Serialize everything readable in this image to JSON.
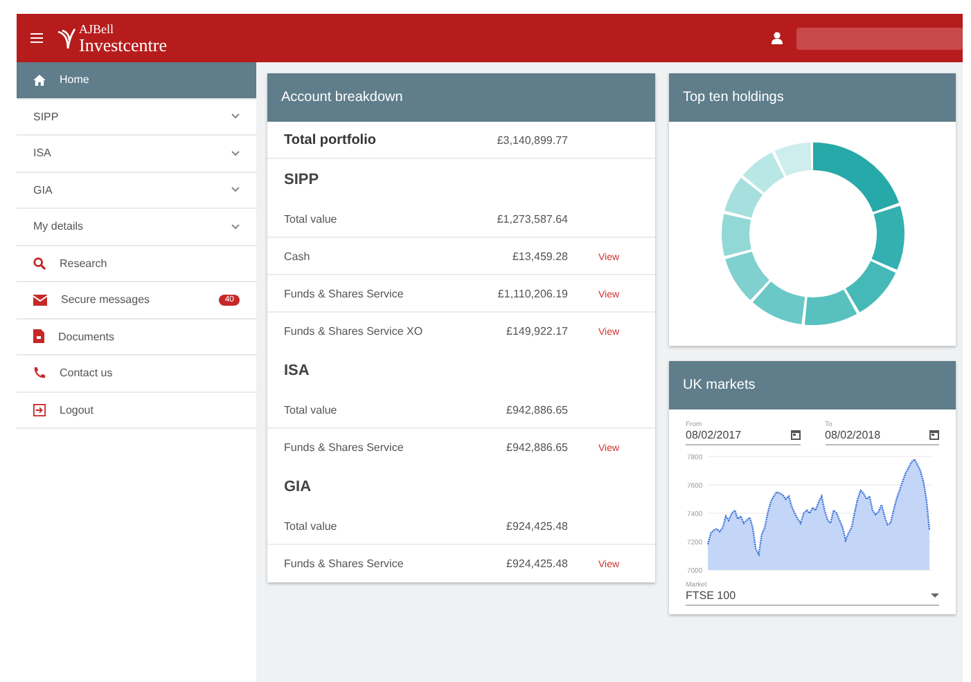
{
  "header": {
    "logo_top": "AJBell",
    "logo_bottom": "Investcentre"
  },
  "sidebar": {
    "items": [
      {
        "label": "Home",
        "kind": "home",
        "selected": true
      },
      {
        "label": "SIPP",
        "kind": "dropdown",
        "selected": false
      },
      {
        "label": "ISA",
        "kind": "dropdown",
        "selected": false
      },
      {
        "label": "GIA",
        "kind": "dropdown",
        "selected": false
      },
      {
        "label": "My details",
        "kind": "dropdown",
        "selected": false
      },
      {
        "label": "Research",
        "kind": "search",
        "selected": false
      },
      {
        "label": "Secure messages",
        "kind": "mail",
        "selected": false,
        "badge": "40"
      },
      {
        "label": "Documents",
        "kind": "document",
        "selected": false
      },
      {
        "label": "Contact us",
        "kind": "phone",
        "selected": false
      },
      {
        "label": "Logout",
        "kind": "logout",
        "selected": false
      }
    ]
  },
  "account_breakdown": {
    "title": "Account breakdown",
    "total_label": "Total portfolio",
    "total_value": "£3,140,899.77",
    "sections": [
      {
        "title": "SIPP",
        "rows": [
          {
            "label": "Total value",
            "value": "£1,273,587.64"
          },
          {
            "label": "Cash",
            "value": "£13,459.28",
            "link": "View"
          },
          {
            "label": "Funds & Shares Service",
            "value": "£1,110,206.19",
            "link": "View"
          },
          {
            "label": "Funds & Shares Service XO",
            "value": "£149,922.17",
            "link": "View"
          }
        ]
      },
      {
        "title": "ISA",
        "rows": [
          {
            "label": "Total value",
            "value": "£942,886.65"
          },
          {
            "label": "Funds & Shares Service",
            "value": "£942,886.65",
            "link": "View"
          }
        ]
      },
      {
        "title": "GIA",
        "rows": [
          {
            "label": "Total value",
            "value": "£924,425.48"
          },
          {
            "label": "Funds & Shares Service",
            "value": "£924,425.48",
            "link": "View"
          }
        ]
      }
    ]
  },
  "top_holdings": {
    "title": "Top ten holdings"
  },
  "uk_markets": {
    "title": "UK markets",
    "from": {
      "label": "From",
      "value": "08/02/2017"
    },
    "to": {
      "label": "To",
      "value": "08/02/2018"
    },
    "chart_data": {
      "type": "area",
      "grid": true,
      "ylim": [
        7000,
        7800
      ],
      "yticks": [
        7000,
        7200,
        7400,
        7600,
        7800
      ],
      "series": [
        {
          "color": "#3b6fd9",
          "values": [
            7180,
            7260,
            7280,
            7290,
            7270,
            7300,
            7380,
            7350,
            7400,
            7420,
            7360,
            7380,
            7330,
            7350,
            7370,
            7300,
            7150,
            7110,
            7250,
            7300,
            7400,
            7480,
            7520,
            7550,
            7540,
            7530,
            7500,
            7520,
            7450,
            7400,
            7360,
            7330,
            7400,
            7420,
            7400,
            7440,
            7420,
            7480,
            7520,
            7420,
            7350,
            7330,
            7420,
            7400,
            7350,
            7300,
            7210,
            7260,
            7300,
            7400,
            7500,
            7560,
            7540,
            7500,
            7520,
            7420,
            7390,
            7410,
            7460,
            7380,
            7320,
            7330,
            7420,
            7500,
            7560,
            7620,
            7680,
            7720,
            7760,
            7780,
            7740,
            7700,
            7620,
            7500,
            7280
          ]
        }
      ]
    },
    "market": {
      "label": "Market",
      "value": "FTSE 100"
    }
  }
}
